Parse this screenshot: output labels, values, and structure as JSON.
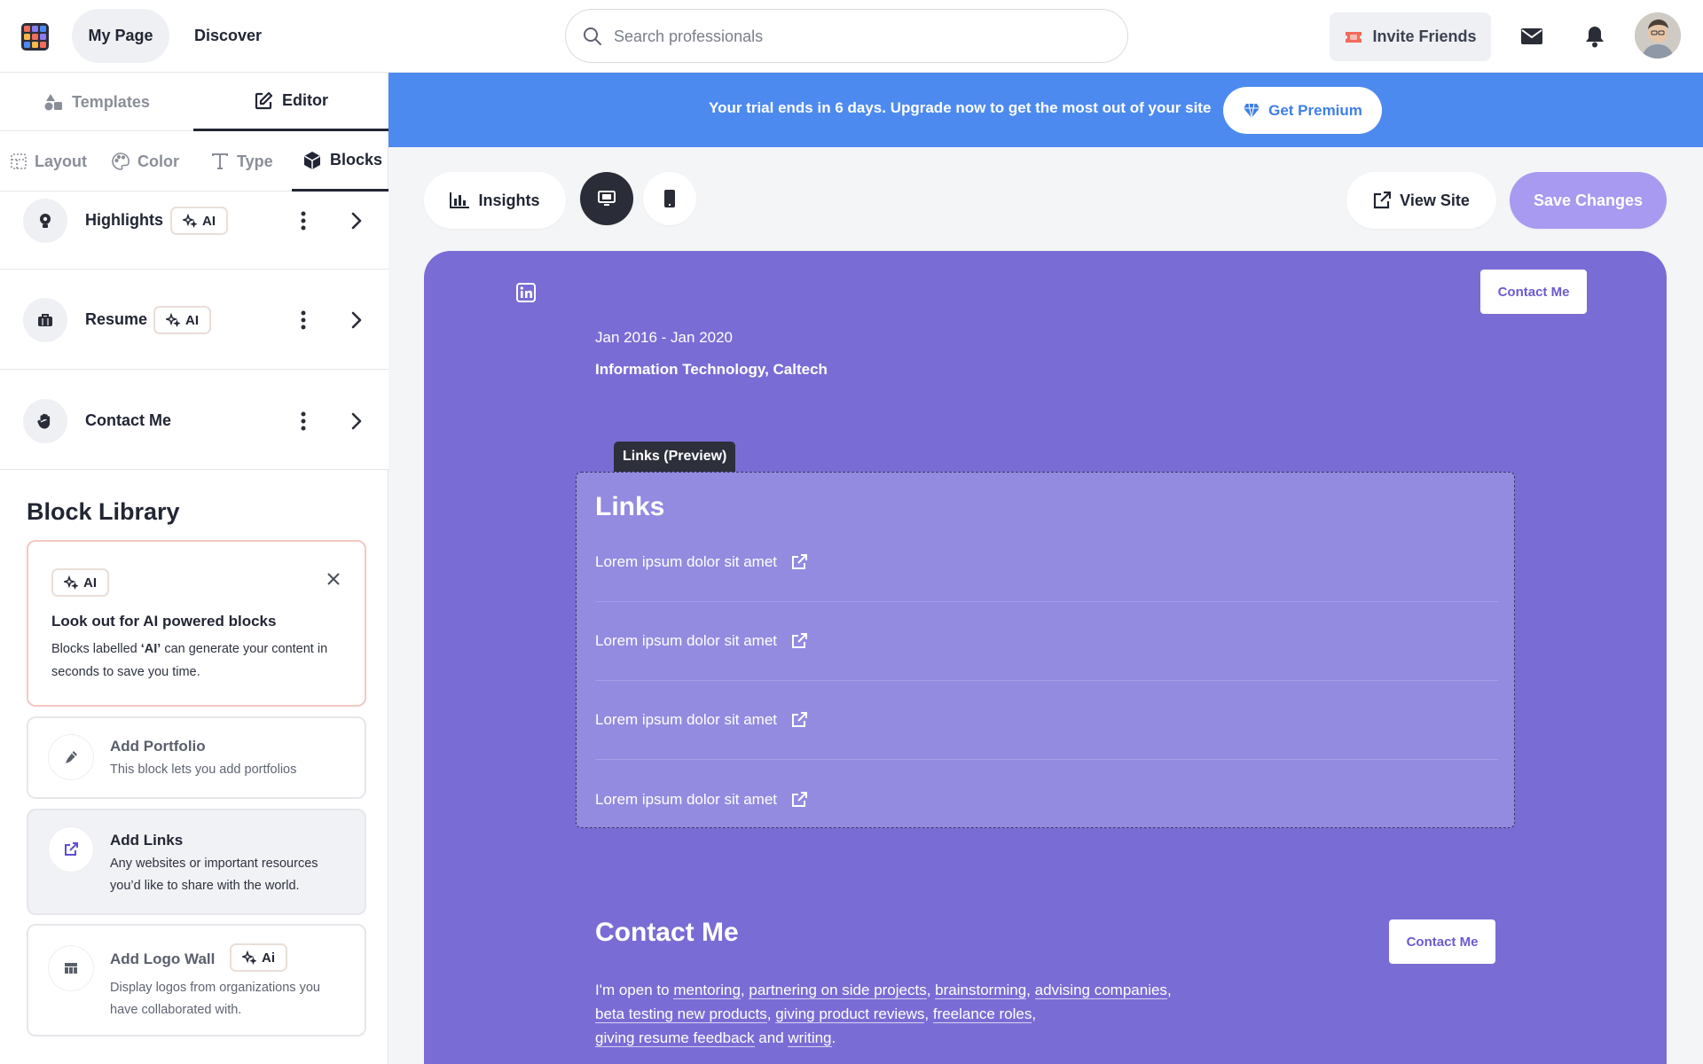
{
  "topbar": {
    "nav": {
      "my_page": "My Page",
      "discover": "Discover"
    },
    "search": {
      "placeholder": "Search professionals",
      "value": ""
    },
    "invite_label": "Invite Friends"
  },
  "sidebar": {
    "tabs": {
      "templates": "Templates",
      "editor": "Editor"
    },
    "subtabs": {
      "layout": "Layout",
      "color": "Color",
      "type": "Type",
      "blocks": "Blocks"
    },
    "blocks": [
      {
        "name": "Highlights",
        "ai_label": "AI"
      },
      {
        "name": "Resume",
        "ai_label": "AI"
      },
      {
        "name": "Contact Me"
      }
    ],
    "library": {
      "title": "Block Library",
      "ai_card": {
        "badge": "AI",
        "title": "Look out for AI powered blocks",
        "desc_pre": "Blocks labelled ",
        "desc_em": "‘AI’",
        "desc_post": " can generate your content in seconds to save you time."
      },
      "cards": [
        {
          "title": "Add Portfolio",
          "desc": "This block lets you add portfolios"
        },
        {
          "title": "Add Links",
          "desc": "Any websites or important resources you’d like to share with the world."
        },
        {
          "title": "Add Logo Wall",
          "badge": "Ai",
          "desc": "Display logos from organizations you have collaborated with."
        }
      ]
    }
  },
  "banner": {
    "text": "Your trial ends in 6 days. Upgrade now to get the most out of your site",
    "premium_label": "Get Premium"
  },
  "toolbar": {
    "insights_label": "Insights",
    "view_site_label": "View Site",
    "save_label": "Save Changes"
  },
  "canvas": {
    "contact_button": "Contact Me",
    "education": {
      "dates": "Jan 2016 - Jan 2020",
      "school": "Information Technology, Caltech"
    },
    "links_preview_tag": "Links (Preview)",
    "links_title": "Links",
    "links": [
      "Lorem ipsum dolor sit amet",
      "Lorem ipsum dolor sit amet",
      "Lorem ipsum dolor sit amet",
      "Lorem ipsum dolor sit amet"
    ],
    "contact": {
      "title": "Contact Me",
      "button": "Contact Me",
      "intro": "I'm open to",
      "items": [
        "mentoring",
        "partnering on side projects",
        "brainstorming",
        "advising companies",
        "beta testing new products",
        "giving product reviews",
        "freelance roles",
        "giving resume feedback",
        "writing"
      ],
      "and_word": "and"
    }
  },
  "colors": {
    "banner": "#4d8af0",
    "canvas": "#7a6cd5",
    "save_button": "#a79af0",
    "premium_text": "#3e7fe6",
    "invite_icon": "#f26b5b"
  },
  "icons": {
    "logo": "grid-logo-icon",
    "search": "search-icon",
    "invite": "ticket-icon",
    "mail": "mail-icon",
    "bell": "bell-icon",
    "templates": "shapes-icon",
    "editor": "edit-icon",
    "layout": "layout-icon",
    "color": "palette-icon",
    "type": "type-icon",
    "blocks": "cube-icon",
    "highlights": "bulb-icon",
    "resume": "briefcase-icon",
    "contact": "hand-icon",
    "portfolio": "pen-icon",
    "links": "external-link-icon",
    "logo_wall": "building-icon",
    "insights": "bar-chart-icon",
    "desktop": "desktop-icon",
    "mobile": "mobile-icon",
    "view_site": "external-link-icon",
    "linkedin": "linkedin-icon",
    "premium": "diamond-icon"
  }
}
